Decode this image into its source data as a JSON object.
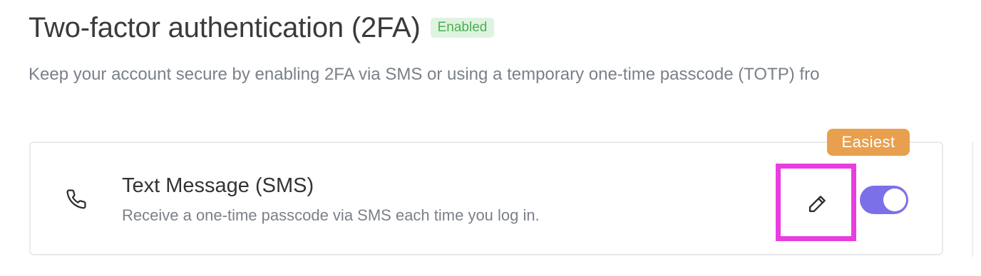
{
  "header": {
    "title": "Two-factor authentication (2FA)",
    "status_badge": "Enabled",
    "subtitle": "Keep your account secure by enabling 2FA via SMS or using a temporary one-time passcode (TOTP) fro"
  },
  "sms_method": {
    "recommendation_badge": "Easiest",
    "title": "Text Message (SMS)",
    "description": "Receive a one-time passcode via SMS each time you log in.",
    "icon": "phone-icon",
    "edit_icon": "pencil-icon",
    "enabled": true
  },
  "colors": {
    "toggle_on": "#7c70e8",
    "badge_enabled_bg": "#dff3e1",
    "badge_enabled_text": "#4caf50",
    "badge_easiest_bg": "#e9a04e",
    "highlight": "#e83ee0"
  }
}
